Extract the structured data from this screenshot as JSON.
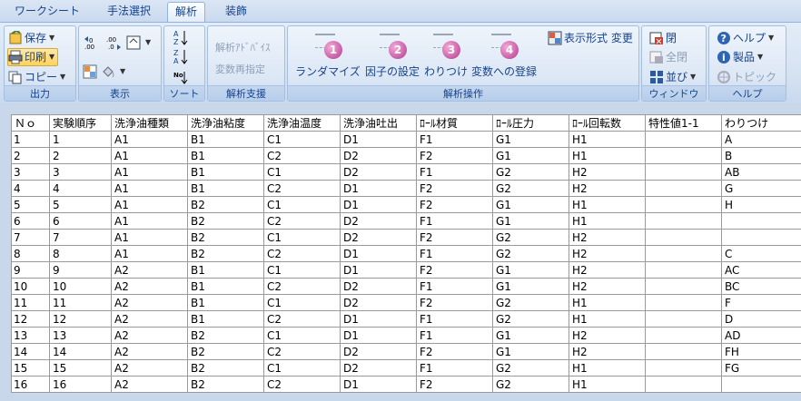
{
  "tabs": [
    {
      "label": "ワークシート",
      "active": false
    },
    {
      "label": "手法選択",
      "active": false
    },
    {
      "label": "解析",
      "active": true
    },
    {
      "label": "装飾",
      "active": false
    }
  ],
  "ribbon": {
    "output": {
      "label": "出力",
      "save": "保存",
      "print": "印刷",
      "copy": "コピー"
    },
    "display": {
      "label": "表示"
    },
    "sort": {
      "label": "ソート"
    },
    "support": {
      "label": "解析支援",
      "advice": "解析ｱﾄﾞﾊﾞｲｽ",
      "respec": "変数再指定"
    },
    "ops": {
      "label": "解析操作",
      "buttons": [
        {
          "label": "ランダマイズ",
          "num": "1"
        },
        {
          "label": "因子の設定",
          "num": "2"
        },
        {
          "label": "わりつけ",
          "num": "3"
        },
        {
          "label": "変数への登録",
          "num": "4"
        }
      ],
      "format_change": "表示形式 変更"
    },
    "window": {
      "label": "ウィンドウ",
      "close": "閉",
      "all_close": "全閉",
      "arrange": "並び"
    },
    "help": {
      "label": "ヘルプ",
      "help": "ヘルプ",
      "product": "製品",
      "topic": "トピック"
    }
  },
  "icons": {
    "save": "save-icon",
    "print": "printer-icon",
    "copy": "copy-icon",
    "close": "close-window-icon",
    "help": "help-icon",
    "info": "info-icon"
  },
  "colors": {
    "ribbon_bg": "#dce7f5",
    "text_blue": "#15428b",
    "badge_pink": "#c04a9a",
    "print_highlight": "#ffd35c"
  },
  "grid": {
    "headers": [
      "Ｎｏ",
      "実験順序",
      "洗浄油種類",
      "洗浄油粘度",
      "洗浄油温度",
      "洗浄油吐出",
      "ﾛｰﾙ材質",
      "ﾛｰﾙ圧力",
      "ﾛｰﾙ回転数",
      "特性値1-1",
      "わりつけ"
    ],
    "rows": [
      [
        "1",
        "1",
        "A1",
        "B1",
        "C1",
        "D1",
        "F1",
        "G1",
        "H1",
        "",
        "A"
      ],
      [
        "2",
        "2",
        "A1",
        "B1",
        "C2",
        "D2",
        "F2",
        "G1",
        "H1",
        "",
        "B"
      ],
      [
        "3",
        "3",
        "A1",
        "B1",
        "C1",
        "D2",
        "F1",
        "G2",
        "H2",
        "",
        "AB"
      ],
      [
        "4",
        "4",
        "A1",
        "B1",
        "C2",
        "D1",
        "F2",
        "G2",
        "H2",
        "",
        "G"
      ],
      [
        "5",
        "5",
        "A1",
        "B2",
        "C1",
        "D1",
        "F2",
        "G1",
        "H1",
        "",
        "H"
      ],
      [
        "6",
        "6",
        "A1",
        "B2",
        "C2",
        "D2",
        "F1",
        "G1",
        "H1",
        "",
        ""
      ],
      [
        "7",
        "7",
        "A1",
        "B2",
        "C1",
        "D2",
        "F2",
        "G2",
        "H2",
        "",
        ""
      ],
      [
        "8",
        "8",
        "A1",
        "B2",
        "C2",
        "D1",
        "F1",
        "G2",
        "H2",
        "",
        "C"
      ],
      [
        "9",
        "9",
        "A2",
        "B1",
        "C1",
        "D1",
        "F2",
        "G1",
        "H2",
        "",
        "AC"
      ],
      [
        "10",
        "10",
        "A2",
        "B1",
        "C2",
        "D2",
        "F1",
        "G1",
        "H2",
        "",
        "BC"
      ],
      [
        "11",
        "11",
        "A2",
        "B1",
        "C1",
        "D2",
        "F2",
        "G2",
        "H1",
        "",
        "F"
      ],
      [
        "12",
        "12",
        "A2",
        "B1",
        "C2",
        "D1",
        "F1",
        "G2",
        "H1",
        "",
        "D"
      ],
      [
        "13",
        "13",
        "A2",
        "B2",
        "C1",
        "D1",
        "F1",
        "G1",
        "H2",
        "",
        "AD"
      ],
      [
        "14",
        "14",
        "A2",
        "B2",
        "C2",
        "D2",
        "F2",
        "G1",
        "H2",
        "",
        "FH"
      ],
      [
        "15",
        "15",
        "A2",
        "B2",
        "C1",
        "D2",
        "F1",
        "G2",
        "H1",
        "",
        "FG"
      ],
      [
        "16",
        "16",
        "A2",
        "B2",
        "C2",
        "D1",
        "F2",
        "G2",
        "H1",
        "",
        ""
      ]
    ]
  }
}
